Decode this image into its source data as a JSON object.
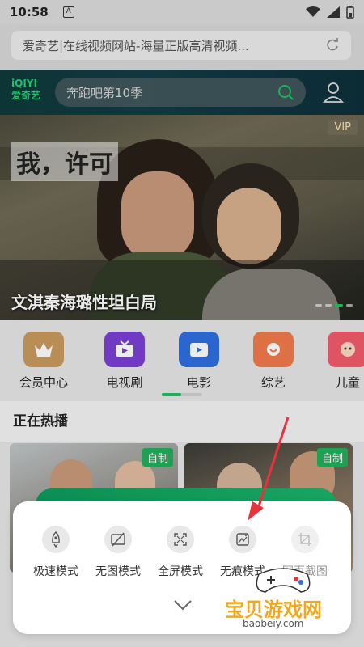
{
  "status_bar": {
    "time": "10:58",
    "notif_letter": "A"
  },
  "browser": {
    "url_title": "爱奇艺|在线视频网站-海量正版高清视频...",
    "refresh_icon": "refresh-icon"
  },
  "site_header": {
    "logo_top": "iQIYI",
    "logo_bottom": "爱奇艺",
    "search_placeholder": "奔跑吧第10季"
  },
  "banner": {
    "poster_title": "我，许可",
    "vip": "VIP",
    "caption": "文淇秦海璐性坦白局"
  },
  "categories": [
    {
      "label": "会员中心",
      "color": "#c99a5e"
    },
    {
      "label": "电视剧",
      "color": "#7b3fd6"
    },
    {
      "label": "电影",
      "color": "#2f6fe0"
    },
    {
      "label": "综艺",
      "color": "#f07a4a"
    },
    {
      "label": "儿童",
      "color": "#f25c6b"
    }
  ],
  "section": {
    "title": "正在热播"
  },
  "thumbs": [
    {
      "badge": "自制"
    },
    {
      "badge": "自制"
    }
  ],
  "panel": {
    "modes": [
      {
        "label": "极速模式",
        "icon": "rocket-icon",
        "enabled": true
      },
      {
        "label": "无图模式",
        "icon": "no-image-icon",
        "enabled": true
      },
      {
        "label": "全屏模式",
        "icon": "fullscreen-icon",
        "enabled": true
      },
      {
        "label": "无痕模式",
        "icon": "incognito-icon",
        "enabled": true
      },
      {
        "label": "网页截图",
        "icon": "crop-icon",
        "enabled": false
      }
    ]
  },
  "watermark": {
    "text": "宝贝游戏网",
    "url": "baobeiy.com"
  },
  "colors": {
    "accent_green": "#19c45e",
    "arrow_red": "#e8323c"
  }
}
